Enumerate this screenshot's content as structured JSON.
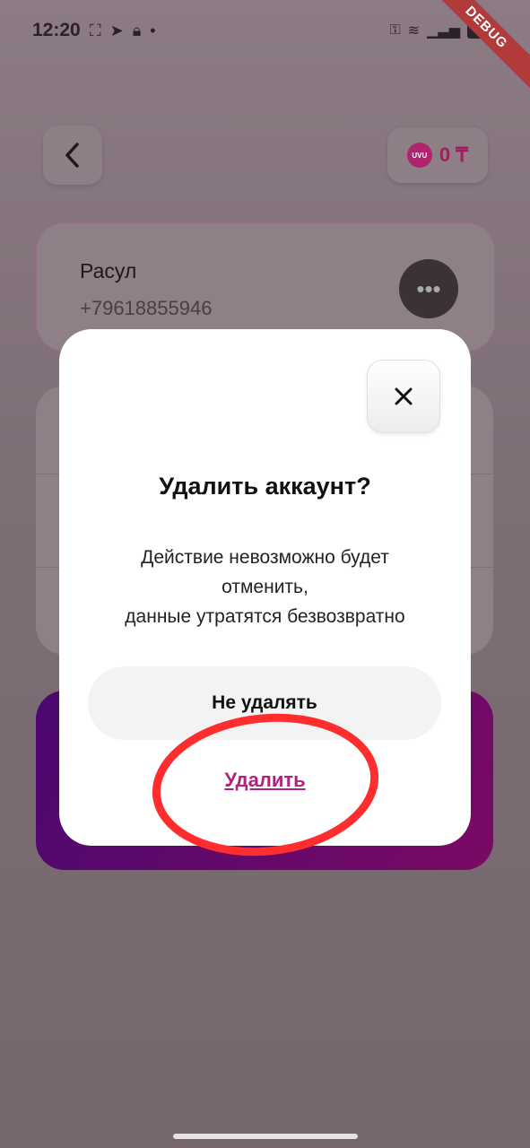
{
  "status_bar": {
    "time": "12:20",
    "debug_label": "DEBUG"
  },
  "header": {
    "balance": "0 ₸",
    "coin_label": "UVU"
  },
  "profile": {
    "name": "Расул",
    "phone": "+79618855946"
  },
  "dialog": {
    "title": "Удалить аккаунт?",
    "message": "Действие невозможно будет\nотменить,\nданные утратятся безвозвратно",
    "keep_label": "Не удалять",
    "delete_label": "Удалить"
  },
  "colors": {
    "accent": "#b0237a",
    "annotation": "#ff2d2d",
    "overlay": "#7c6a72"
  }
}
